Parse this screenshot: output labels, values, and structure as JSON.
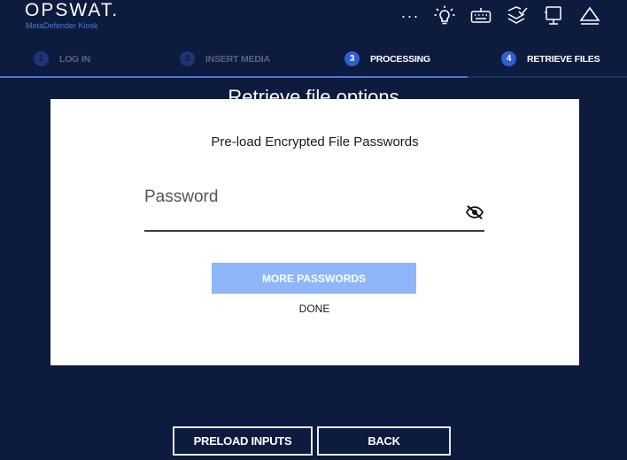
{
  "header": {
    "logo": "OPSWAT.",
    "subtitle": "MetaDefender Kiosk",
    "more_menu": "···",
    "icons": [
      "more-icon",
      "lightbulb-icon",
      "keyboard-icon",
      "layers-check-icon",
      "kiosk-icon",
      "eject-icon"
    ]
  },
  "steps": [
    {
      "num": "1",
      "label": "LOG IN",
      "state": "done"
    },
    {
      "num": "2",
      "label": "INSERT MEDIA",
      "state": "done"
    },
    {
      "num": "3",
      "label": "PROCESSING",
      "state": "active"
    },
    {
      "num": "4",
      "label": "RETRIEVE FILES",
      "state": "pending"
    }
  ],
  "background_title": "Retrieve file options",
  "dialog": {
    "title": "Pre-load Encrypted File Passwords",
    "password_placeholder": "Password",
    "password_value": "",
    "more_passwords_label": "MORE PASSWORDS",
    "done_label": "DONE"
  },
  "footer": {
    "preload_label": "PRELOAD INPUTS",
    "back_label": "BACK"
  },
  "colors": {
    "background": "#0d1b3f",
    "accent": "#2f5fd0",
    "button_light": "#8eb6f9"
  }
}
